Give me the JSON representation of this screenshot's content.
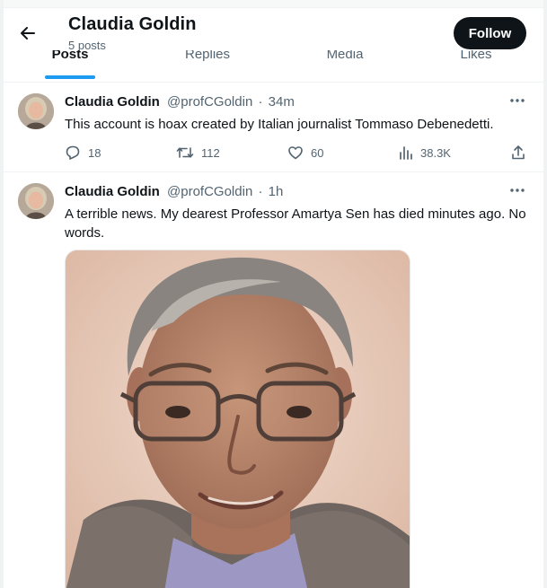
{
  "header": {
    "name": "Claudia Goldin",
    "post_count": "5 posts",
    "follow_label": "Follow"
  },
  "tabs": [
    {
      "label": "Posts",
      "active": true
    },
    {
      "label": "Replies",
      "active": false
    },
    {
      "label": "Media",
      "active": false
    },
    {
      "label": "Likes",
      "active": false
    }
  ],
  "tweets": [
    {
      "name": "Claudia Goldin",
      "handle": "@profCGoldin",
      "dot": "·",
      "time": "34m",
      "text": "This account is hoax created by Italian journalist Tommaso Debenedetti.",
      "replies": "18",
      "reposts": "112",
      "likes": "60",
      "views": "38.3K"
    },
    {
      "name": "Claudia Goldin",
      "handle": "@profCGoldin",
      "dot": "·",
      "time": "1h",
      "text": "A terrible news. My dearest Professor Amartya Sen has died minutes ago. No words."
    }
  ],
  "colors": {
    "accent": "#1d9bf0",
    "text_primary": "#0f1419",
    "text_secondary": "#536471",
    "follow_bg": "#0f1419"
  }
}
